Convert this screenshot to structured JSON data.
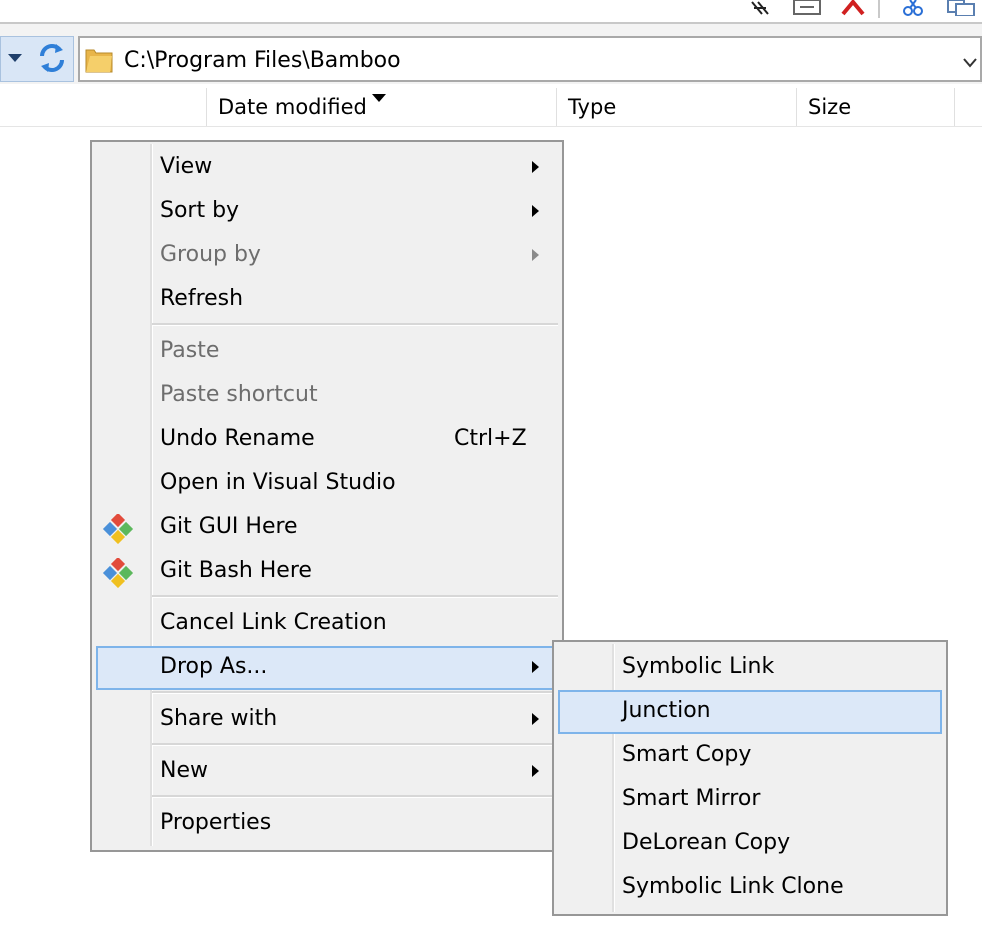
{
  "address": {
    "path": "C:\\Program Files\\Bamboo"
  },
  "columns": {
    "date_modified": "Date modified",
    "type": "Type",
    "size": "Size"
  },
  "context_menu": {
    "view": "View",
    "sort_by": "Sort by",
    "group_by": "Group by",
    "refresh": "Refresh",
    "paste": "Paste",
    "paste_shortcut": "Paste shortcut",
    "undo_rename": "Undo Rename",
    "undo_shortcut": "Ctrl+Z",
    "open_vs": "Open in Visual Studio",
    "git_gui": "Git GUI Here",
    "git_bash": "Git Bash Here",
    "cancel_link": "Cancel Link Creation",
    "drop_as": "Drop As...",
    "share_with": "Share with",
    "new": "New",
    "properties": "Properties"
  },
  "submenu": {
    "symbolic_link": "Symbolic Link",
    "junction": "Junction",
    "smart_copy": "Smart Copy",
    "smart_mirror": "Smart Mirror",
    "delorean_copy": "DeLorean Copy",
    "symbolic_link_clone": "Symbolic Link Clone"
  },
  "icons": {
    "refresh": "refresh-icon",
    "folder": "folder-icon",
    "git": "git-icon"
  },
  "colors": {
    "highlight_bg": "#dce8f8",
    "highlight_border": "#7eb4ea",
    "menu_bg": "#f0f0f0",
    "disabled_text": "#6d6d6d"
  }
}
